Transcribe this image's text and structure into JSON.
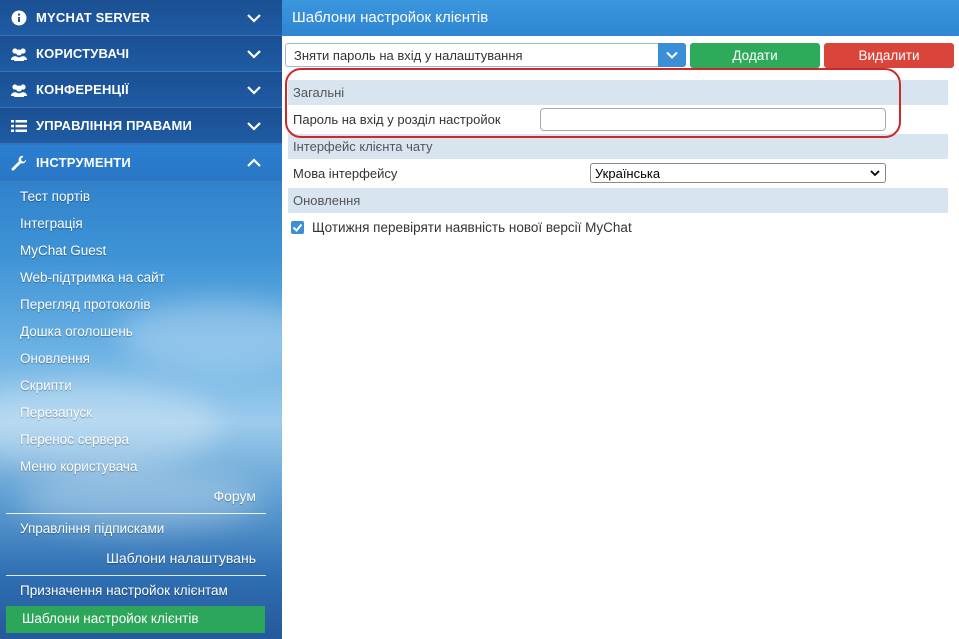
{
  "sidebar": {
    "groups": [
      {
        "label": "MYCHAT SERVER",
        "icon": "info-icon"
      },
      {
        "label": "КОРИСТУВАЧІ",
        "icon": "users-icon"
      },
      {
        "label": "КОНФЕРЕНЦІЇ",
        "icon": "users-icon"
      },
      {
        "label": "УПРАВЛІННЯ ПРАВАМИ",
        "icon": "list-icon"
      },
      {
        "label": "ІНСТРУМЕНТИ",
        "icon": "wrench-icon",
        "expanded": true
      }
    ],
    "tools": [
      "Тест портів",
      "Інтеграція",
      "MyChat Guest",
      "Web-підтримка на сайт",
      "Перегляд протоколів",
      "Дошка оголошень",
      "Оновлення",
      "Скрипти",
      "Перезапуск",
      "Перенос сервера",
      "Меню користувача"
    ],
    "forum_header": "Форум",
    "forum_items": [
      "Управління підписками"
    ],
    "templates_header": "Шаблони налаштувань",
    "template_items": [
      "Призначення настройок клієнтам",
      "Шаблони настройок клієнтів"
    ],
    "active_item": "Шаблони настройок клієнтів"
  },
  "main": {
    "title": "Шаблони настройок клієнтів",
    "template_select": {
      "value": "Зняти пароль на вхід у налаштування"
    },
    "add_label": "Додати",
    "delete_label": "Видалити",
    "sections": {
      "general": "Загальні",
      "password_label": "Пароль на вхід у розділ настройок",
      "password_value": "",
      "chat_interface": "Інтерфейс клієнта чату",
      "language_label": "Мова інтерфейсу",
      "language_value": "Українська",
      "updates": "Оновлення",
      "weekly_check_label": "Щотижня перевіряти наявність нової версії MyChat",
      "weekly_check_checked": true
    }
  },
  "colors": {
    "title_bar": "#3b96de",
    "add_button": "#2eaa5b",
    "delete_button": "#d9453a",
    "active_menu": "#2ca65a",
    "highlight": "#cc2a2a"
  }
}
